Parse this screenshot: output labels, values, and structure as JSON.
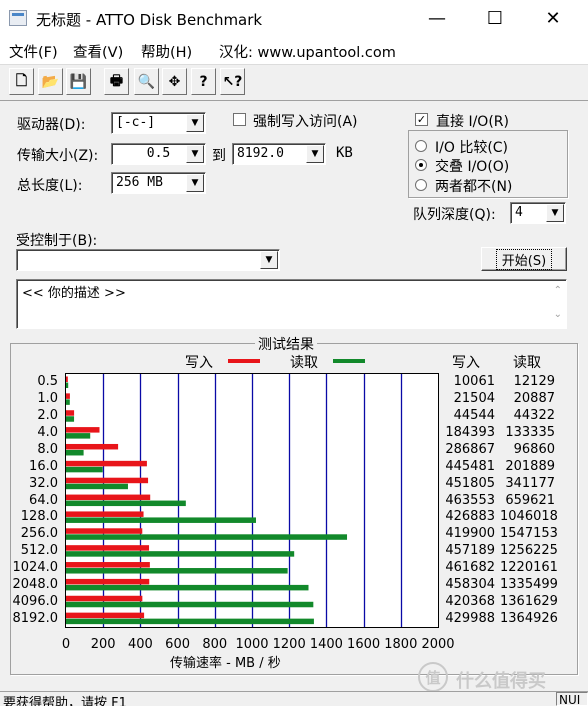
{
  "window": {
    "title": "无标题 - ATTO Disk Benchmark",
    "minimize": "—",
    "maximize": "☐",
    "close": "✕"
  },
  "menu": {
    "file": "文件(F)",
    "view": "查看(V)",
    "help": "帮助(H)",
    "localized": "汉化: www.upantool.com"
  },
  "toolbar": {
    "buttons": [
      {
        "icon": "new-document-icon",
        "glyph": "🗋"
      },
      {
        "icon": "open-folder-icon",
        "glyph": "📂"
      },
      {
        "icon": "save-disk-icon",
        "glyph": "💾"
      },
      {
        "icon": "print-icon",
        "glyph": "🖶"
      },
      {
        "icon": "print-preview-icon",
        "glyph": "🔍"
      },
      {
        "icon": "move-crosshair-icon",
        "glyph": "✥"
      },
      {
        "icon": "help-question-icon",
        "glyph": "?"
      },
      {
        "icon": "context-help-icon",
        "glyph": "↖?"
      }
    ]
  },
  "settings": {
    "drive_label": "驱动器(D):",
    "drive_value": "[-c-]",
    "force_write_label": "强制写入访问(A)",
    "direct_io_label": "直接 I/O(R)",
    "transfer_size_label": "传输大小(Z):",
    "transfer_from": "0.5",
    "to_label": "到",
    "transfer_to": "8192.0",
    "unit_kb": "KB",
    "total_length_label": "总长度(L):",
    "total_length_value": "256 MB",
    "io_compare_label": "I/O 比较(C)",
    "overlapped_io_label": "交叠 I/O(O)",
    "neither_label": "两者都不(N)",
    "queue_depth_label": "队列深度(Q):",
    "queue_depth_value": "4",
    "controlled_by_label": "受控制于(B):",
    "controlled_by_value": "",
    "start_button": "开始(S)",
    "description": "<<   你的描述    >>"
  },
  "results": {
    "title": "测试结果",
    "legend_write": "写入",
    "legend_read": "读取",
    "col_write": "写入",
    "col_read": "读取",
    "write_color": "#e8151a",
    "read_color": "#12892b",
    "grid_color": "#0a0aa6"
  },
  "chart_data": {
    "type": "bar",
    "orientation": "horizontal",
    "title": "测试结果",
    "xlabel": "传输速率 - MB / 秒",
    "ylabel": "",
    "xlim": [
      0,
      2000
    ],
    "xticks": [
      0,
      200,
      400,
      600,
      800,
      1000,
      1200,
      1400,
      1600,
      1800,
      2000
    ],
    "categories": [
      "0.5",
      "1.0",
      "2.0",
      "4.0",
      "8.0",
      "16.0",
      "32.0",
      "64.0",
      "128.0",
      "256.0",
      "512.0",
      "1024.0",
      "2048.0",
      "4096.0",
      "8192.0"
    ],
    "series": [
      {
        "name": "写入",
        "values": [
          9.8,
          21.0,
          43.5,
          180.1,
          280.1,
          435.0,
          441.2,
          452.7,
          416.9,
          410.1,
          446.5,
          450.9,
          447.6,
          410.5,
          419.9
        ]
      },
      {
        "name": "读取",
        "values": [
          11.8,
          20.4,
          43.3,
          130.2,
          94.6,
          197.2,
          333.2,
          644.2,
          1021.5,
          1510.9,
          1226.8,
          1191.6,
          1303.8,
          1329.7,
          1332.9
        ]
      }
    ],
    "write_raw": [
      "10061",
      "21504",
      "44544",
      "184393",
      "286867",
      "445481",
      "451805",
      "463553",
      "426883",
      "419900",
      "457189",
      "461682",
      "458304",
      "420368",
      "429988"
    ],
    "read_raw": [
      "12129",
      "20887",
      "44322",
      "133335",
      "96860",
      "201889",
      "341177",
      "659621",
      "1046018",
      "1547153",
      "1256225",
      "1220161",
      "1335499",
      "1361629",
      "1364926"
    ],
    "grid": true,
    "legend": "top"
  },
  "status": {
    "text": "要获得帮助，请按 F1",
    "num": "NUI"
  },
  "watermark": "什么值得买"
}
